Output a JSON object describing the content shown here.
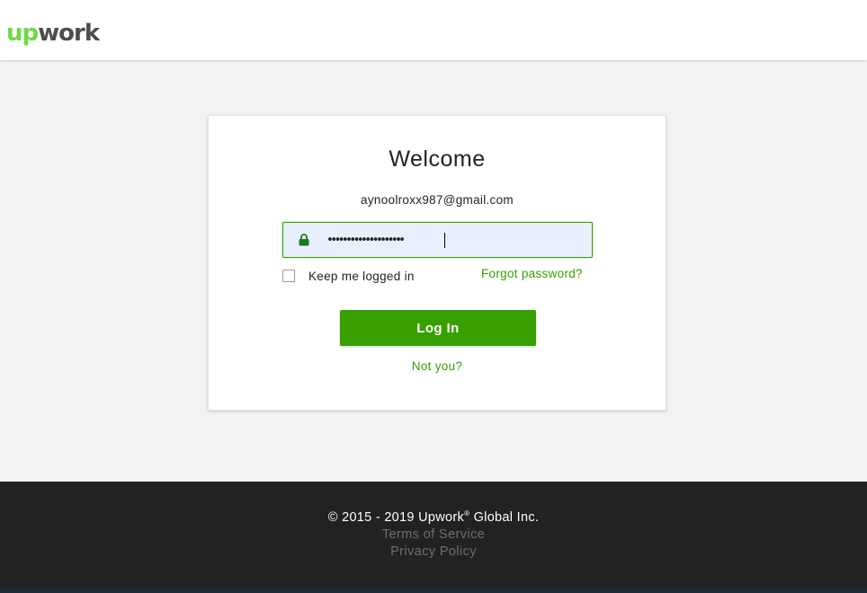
{
  "header": {
    "logo_up": "up",
    "logo_work": "work"
  },
  "login": {
    "title": "Welcome",
    "email": "aynoolroxx987@gmail.com",
    "password_masked": "••••••••••••••••••••",
    "remember_label": "Keep me logged in",
    "remember_checked": false,
    "forgot_label": "Forgot password?",
    "login_button": "Log In",
    "not_you": "Not you?"
  },
  "footer": {
    "copyright_prefix": "© 2015 - 2019 Upwork",
    "copyright_mark": "®",
    "copyright_suffix": " Global Inc.",
    "terms": "Terms of Service",
    "privacy": "Privacy Policy"
  },
  "colors": {
    "brand_green": "#37a000",
    "logo_green": "#6fda44",
    "footer_bg": "#222222",
    "field_bg": "#e8f0fe"
  },
  "icons": {
    "password_field": "lock-icon"
  }
}
